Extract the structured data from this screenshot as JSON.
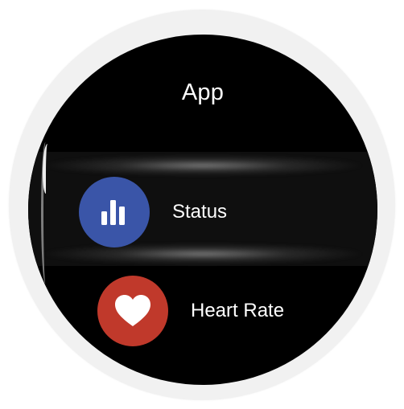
{
  "screen": {
    "title": "App"
  },
  "scrollbar": {
    "visible": true
  },
  "items": [
    {
      "label": "Status",
      "icon": "bar-chart-icon",
      "color": "#3a55a8",
      "selected": true
    },
    {
      "label": "Heart Rate",
      "icon": "heart-icon",
      "color": "#c0392b",
      "selected": false
    }
  ],
  "colors": {
    "screen_background": "#000000",
    "bezel": "#f1f1f1",
    "text": "#ffffff"
  }
}
